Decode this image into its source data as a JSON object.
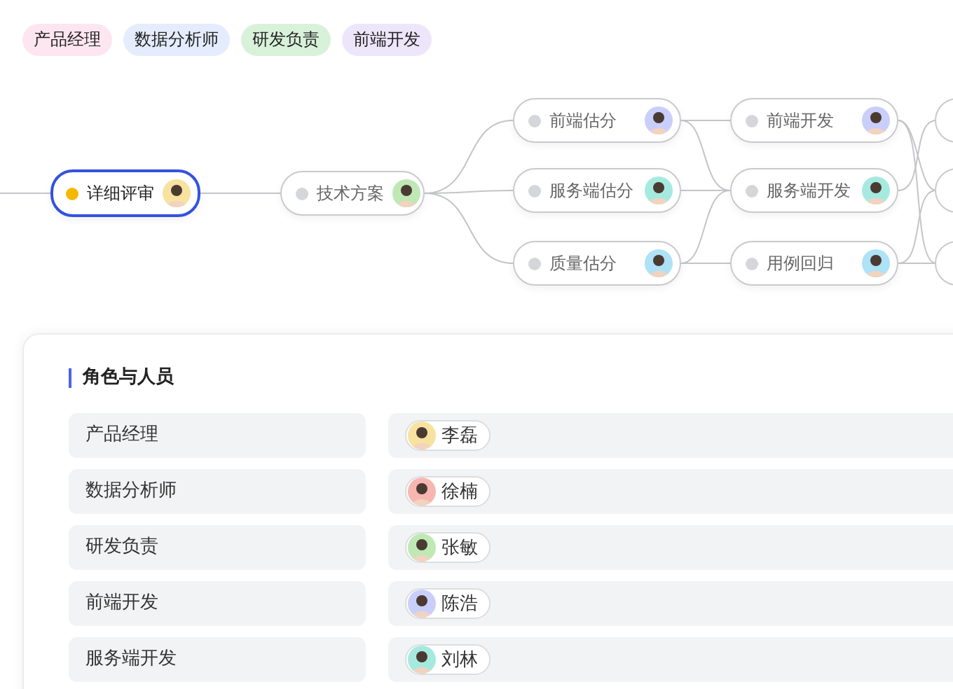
{
  "tags": [
    {
      "label": "产品经理",
      "color": "#fde6ef"
    },
    {
      "label": "数据分析师",
      "color": "#e5ecfd"
    },
    {
      "label": "研发负责",
      "color": "#d8f2da"
    },
    {
      "label": "前端开发",
      "color": "#ede6fb"
    }
  ],
  "flow": {
    "nodes": [
      {
        "label": "详细评审",
        "active": true,
        "selected": true,
        "avatar": {
          "color": "#f8e2a0"
        }
      },
      {
        "label": "技术方案",
        "active": false,
        "selected": false,
        "avatar": {
          "color": "#bfe8b5"
        }
      },
      {
        "label": "前端估分",
        "active": false,
        "selected": false,
        "avatar": {
          "color": "#c9cffa"
        }
      },
      {
        "label": "服务端估分",
        "active": false,
        "selected": false,
        "avatar": {
          "color": "#a6eadf"
        }
      },
      {
        "label": "质量估分",
        "active": false,
        "selected": false,
        "avatar": {
          "color": "#aee2f6"
        }
      },
      {
        "label": "前端开发",
        "active": false,
        "selected": false,
        "avatar": {
          "color": "#c9cffa"
        }
      },
      {
        "label": "服务端开发",
        "active": false,
        "selected": false,
        "avatar": {
          "color": "#a6eadf"
        }
      },
      {
        "label": "用例回归",
        "active": false,
        "selected": false,
        "avatar": {
          "color": "#aee2f6"
        }
      }
    ]
  },
  "roles_panel": {
    "title": "角色与人员",
    "rows": [
      {
        "role": "产品经理",
        "person": "李磊",
        "avatar": {
          "color": "#f8e2a0"
        }
      },
      {
        "role": "数据分析师",
        "person": "徐楠",
        "avatar": {
          "color": "#f6b7b0"
        }
      },
      {
        "role": "研发负责",
        "person": "张敏",
        "avatar": {
          "color": "#bfe8b5"
        }
      },
      {
        "role": "前端开发",
        "person": "陈浩",
        "avatar": {
          "color": "#c9cffa"
        }
      },
      {
        "role": "服务端开发",
        "person": "刘林",
        "avatar": {
          "color": "#a6eadf"
        }
      }
    ]
  }
}
